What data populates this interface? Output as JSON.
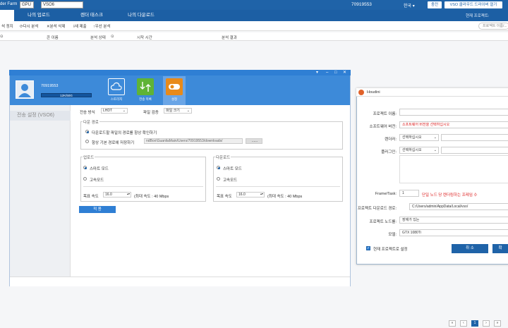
{
  "topbar": {
    "brand": "der Farm",
    "gpu_label": "GPU",
    "version_select": "VSO6",
    "username": "70919553",
    "lang": "한국 ▾",
    "charge_btn": "충전",
    "cloud_btn": "VSO 클라우드 드라이버 열기"
  },
  "tabs": [
    {
      "label": ""
    },
    {
      "label": "나의 업로드"
    },
    {
      "label": "렌더 태스크"
    },
    {
      "label": "나의 다운로드"
    }
  ],
  "project_count": "현재 프로젝트:",
  "toolbar": {
    "items": [
      "석 정지",
      "다시 분석",
      "분석 삭제",
      "새 제출",
      "우선 분석"
    ],
    "search_placeholder": "프로젝트 이름/..."
  },
  "table_header": [
    "",
    "콘 이름",
    "분석 상태",
    "시작 시간",
    "분석 결과"
  ],
  "window": {
    "username": "70919553",
    "quota": "12K/50G",
    "icons": [
      {
        "label": "스토리지",
        "color": "#3d8ad9"
      },
      {
        "label": "전송 목록",
        "color": "#5fb336"
      },
      {
        "label": "설정",
        "color": "#e88a1a"
      }
    ],
    "sidebar_item": "전송 설정 (VSO6)",
    "transfer_mode_label": "전송 방식",
    "transfer_mode_value": "LHDT",
    "file_check_label": "파일 검증",
    "file_check_value": "파일 크기",
    "path_group_title": "다운 경로",
    "path_option1": "다운로드할 파일의 경로를 항상 확인하기",
    "path_option2": "항상 기본 경로에 저장하기",
    "path_value": "ndBox\\GuanliaMain/Users/70919553/downloads/",
    "path_browse": "......",
    "upload_title": "업로드",
    "download_title": "다운로드",
    "mode_smart": "스마트 모드",
    "mode_fast": "고속모드",
    "target_speed_label": "목표 속도",
    "target_speed_value": "16.0",
    "max_speed_label": "(최대 속도 : 40 Mbps",
    "apply_btn": "적 용"
  },
  "houdini": {
    "title": "Houdini",
    "project_name_label": "프로젝트 이름:",
    "software_label": "소프트웨어 버전:",
    "software_value": "소프트웨어 버전을 선택하십시오",
    "renderer_label": "렌더러:",
    "renderer_value": "선택하십시오",
    "plugin_label": "플러그인:",
    "plugin_value": "선택하십시오",
    "frame_label": "Frame/Task:",
    "frame_value": "1",
    "frame_hint": "단일 노드 당 렌더링하는 프레임 수",
    "download_path_label": "프로젝트 다운로드 경로:",
    "download_path_value": "C:/Users/admin/AppData/Local/vso/",
    "node_label": "프로젝트 노드를:",
    "node_value": "장애가 있는",
    "model_label": "모델:",
    "model_value": "GTX 1080Ti",
    "set_current": "현재 프로젝트로 설정",
    "cancel_btn": "취 소",
    "ok_btn": "확"
  },
  "pagination": [
    "«",
    "‹",
    "1",
    "›",
    "»"
  ]
}
